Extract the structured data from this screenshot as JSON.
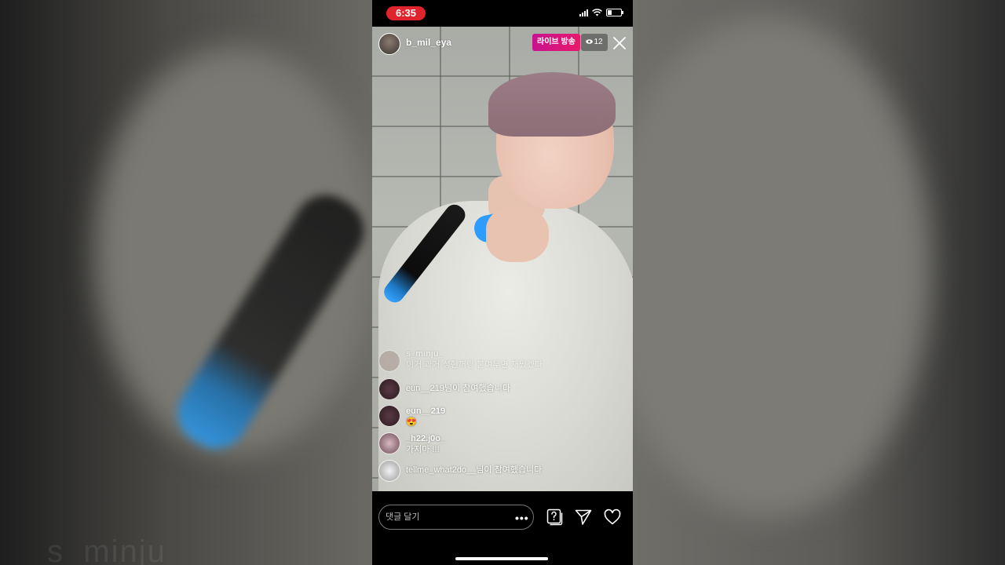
{
  "status": {
    "time": "6:35"
  },
  "live": {
    "host_name": "b_mil_eya",
    "badge": "라이브 방송",
    "viewer_count": "12"
  },
  "comments": [
    {
      "user": "s_minju_",
      "text": "이거 과거 성현꺼랑 붙여두면 재밌겠다"
    },
    {
      "user": "",
      "text": "eun__219님이 참여했습니다"
    },
    {
      "user": "eun__219",
      "text": "😍"
    },
    {
      "user": "_h22.j0o_",
      "text": "가지마 !!!"
    },
    {
      "user": "",
      "text": "tellme_what2do__님이 참여했습니다"
    }
  ],
  "bottom_bar": {
    "input_placeholder": "댓글 달기",
    "more": "•••"
  },
  "background": {
    "caption": "s_minju"
  },
  "colors": {
    "live_badge": "#e8196b",
    "time_pill": "#e0242d"
  },
  "icons": [
    "question-icon",
    "send-icon",
    "heart-icon",
    "close-icon",
    "eye-icon"
  ]
}
